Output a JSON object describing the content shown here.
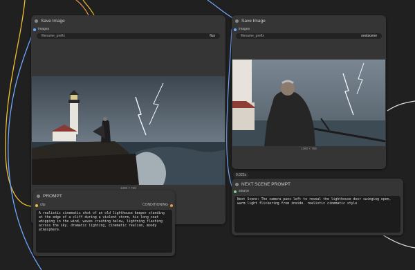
{
  "colors": {
    "canvas": "#202020",
    "node": "#353535",
    "wire_yellow": "#f0c030",
    "wire_blue": "#6fa8ff",
    "wire_orange": "#e39a4f",
    "wire_white": "#dddddd"
  },
  "left_save_node": {
    "title": "Save Image",
    "input_label": "images",
    "widget_label": "filename_prefix",
    "widget_value": "flux",
    "image_size": "1280 × 720"
  },
  "right_save_node": {
    "title": "Save Image",
    "input_label": "images",
    "widget_label": "filename_prefix",
    "widget_value": "nextscene",
    "image_size": "1360 × 768"
  },
  "timing_badge": "0.022s",
  "prompt_node": {
    "title": "PROMPT",
    "input_label": "clip",
    "output_label": "CONDITIONING",
    "text": "A realistic cinematic shot of an old lighthouse keeper standing at the edge of a cliff during a violent storm, his long coat whipping in the wind, waves crashing below, lightning flashing across the sky. dramatic lighting, cinematic realism, moody atmosphere."
  },
  "next_scene_node": {
    "title": "NEXT SCENE PROMPT",
    "input_label": "source",
    "text": "Next Scene: The camera pans left to reveal the lighthouse door swinging open, warm light flickering from inside. realistic cinematic style"
  }
}
